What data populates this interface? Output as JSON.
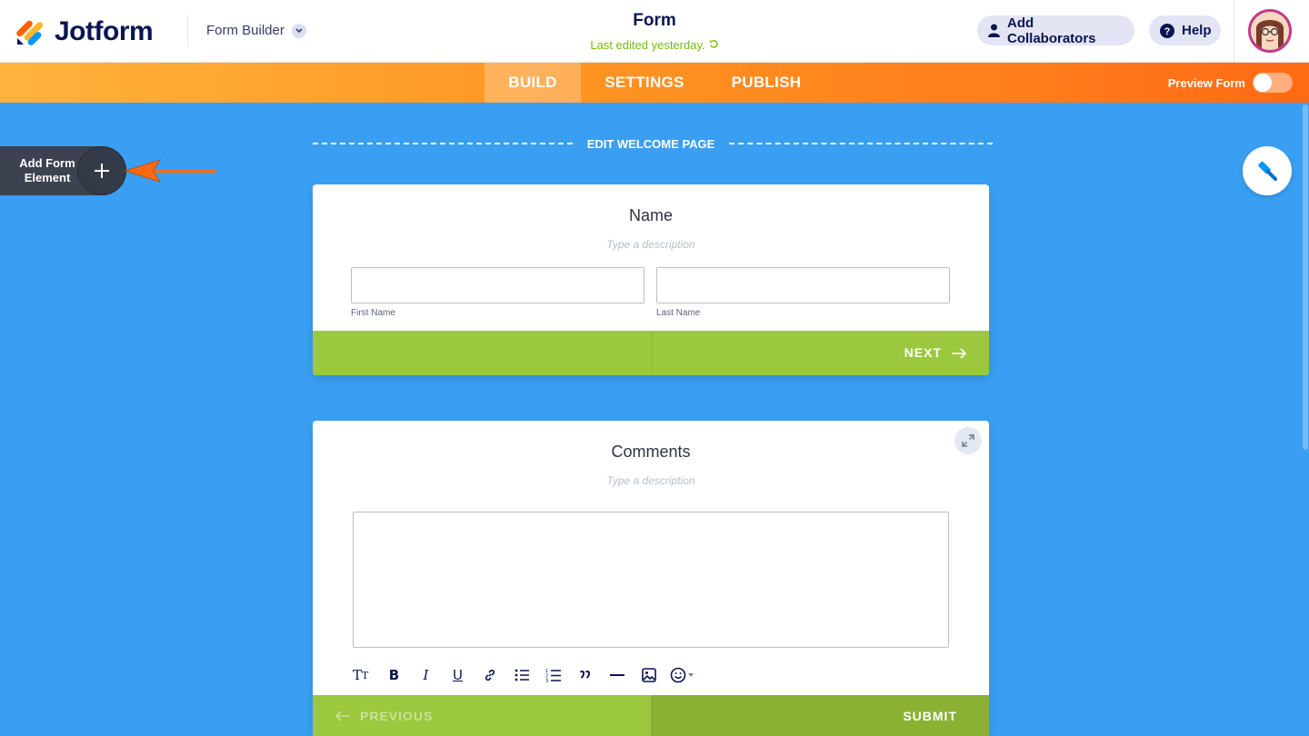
{
  "app": {
    "logo_text": "Jotform",
    "builder_label": "Form Builder",
    "form_title": "Form",
    "last_edited": "Last edited yesterday."
  },
  "header": {
    "collaborators_label": "Add Collaborators",
    "help_label": "Help"
  },
  "nav": {
    "tabs": [
      {
        "label": "BUILD",
        "active": true
      },
      {
        "label": "SETTINGS",
        "active": false
      },
      {
        "label": "PUBLISH",
        "active": false
      }
    ],
    "preview_label": "Preview Form",
    "preview_enabled": false
  },
  "sidebar": {
    "add_element_label": "Add Form Element"
  },
  "canvas": {
    "welcome_label": "EDIT WELCOME PAGE"
  },
  "name_question": {
    "title": "Name",
    "description_placeholder": "Type a description",
    "first_sublabel": "First Name",
    "last_sublabel": "Last Name",
    "next_label": "NEXT"
  },
  "comments_question": {
    "title": "Comments",
    "description_placeholder": "Type a description",
    "previous_label": "PREVIOUS",
    "submit_label": "SUBMIT",
    "toolbar_icons": [
      "text-size-icon",
      "bold-icon",
      "italic-icon",
      "underline-icon",
      "link-icon",
      "bulleted-list-icon",
      "numbered-list-icon",
      "quote-icon",
      "horizontal-rule-icon",
      "image-icon",
      "emoji-icon"
    ]
  },
  "colors": {
    "canvas_bg": "#3a9ff2",
    "nav_orange": "#ff7b1c",
    "footer_green": "#9bc83e",
    "brand_navy": "#0a1551",
    "edited_green": "#78bb07"
  }
}
